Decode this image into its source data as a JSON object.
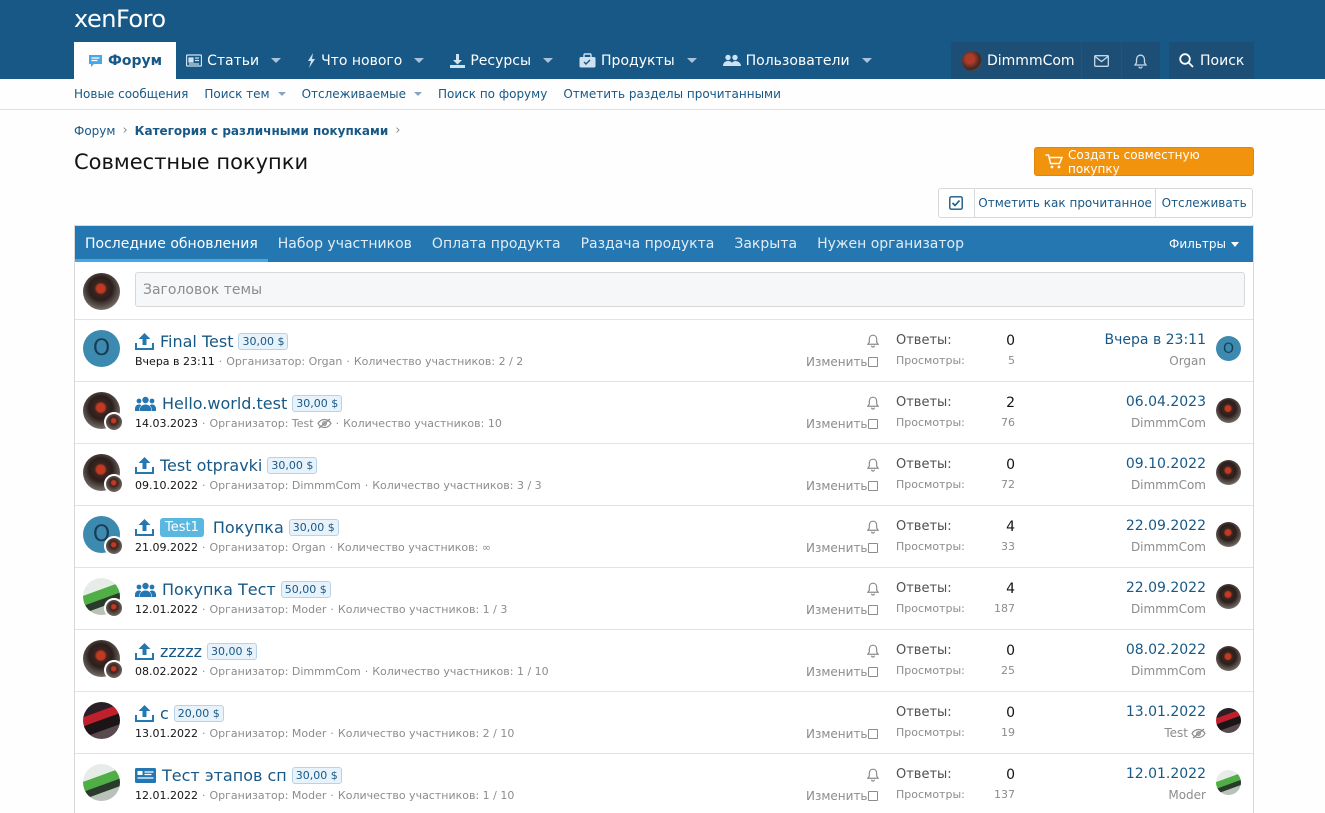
{
  "header": {
    "logo": "xenForo",
    "nav": [
      {
        "label": "Форум",
        "icon": "forum-icon",
        "active": true
      },
      {
        "label": "Статьи",
        "icon": "articles-icon"
      },
      {
        "label": "Что нового",
        "icon": "whats-new-icon"
      },
      {
        "label": "Ресурсы",
        "icon": "resources-icon"
      },
      {
        "label": "Продукты",
        "icon": "products-icon"
      },
      {
        "label": "Пользователи",
        "icon": "users-icon"
      }
    ],
    "user_name": "DimmmCom",
    "search_label": "Поиск"
  },
  "subnav": {
    "items": [
      {
        "label": "Новые сообщения"
      },
      {
        "label": "Поиск тем"
      },
      {
        "label": "Отслеживаемые"
      },
      {
        "label": "Поиск по форуму"
      },
      {
        "label": "Отметить разделы прочитанными"
      }
    ]
  },
  "breadcrumb": {
    "root": "Форум",
    "category": "Категория с различными покупками"
  },
  "page": {
    "title": "Совместные покупки",
    "create_button": "Создать совместную покупку",
    "mark_read": "Отметить как прочитанное",
    "watch": "Отслеживать"
  },
  "tabs": {
    "items": [
      {
        "label": "Последние обновления",
        "active": true
      },
      {
        "label": "Набор участников"
      },
      {
        "label": "Оплата продукта"
      },
      {
        "label": "Раздача продукта"
      },
      {
        "label": "Закрыта"
      },
      {
        "label": "Нужен организатор"
      }
    ],
    "filters": "Фильтры"
  },
  "quick_thread": {
    "placeholder": "Заголовок темы"
  },
  "labels": {
    "replies": "Ответы:",
    "views": "Просмотры:",
    "edit": "Изменить",
    "organizer": "Организатор:",
    "participants": "Количество участников:"
  },
  "threads": [
    {
      "icon": "upload-icon",
      "title": "Final Test",
      "price": "30,00 $",
      "prefix": "",
      "date": "Вчера в 23:11",
      "organizer": "Organ",
      "participants": "2 / 2",
      "replies": "0",
      "views": "5",
      "last_date": "Вчера в 23:11",
      "last_user": "Organ",
      "avatar": "letter",
      "avatar_letter": "O",
      "mini": false,
      "last_avatar": "letter",
      "bell": true,
      "organizer_hidden": false,
      "last_hidden": false
    },
    {
      "icon": "group-icon",
      "title": "Hello.world.test",
      "price": "30,00 $",
      "prefix": "",
      "date": "14.03.2023",
      "organizer": "Test",
      "participants": "10",
      "replies": "2",
      "views": "76",
      "last_date": "06.04.2023",
      "last_user": "DimmmCom",
      "avatar": "char",
      "avatar_letter": "",
      "mini": true,
      "last_avatar": "char",
      "bell": true,
      "organizer_hidden": true,
      "last_hidden": false
    },
    {
      "icon": "upload-icon",
      "title": "Test otpravki",
      "price": "30,00 $",
      "prefix": "",
      "date": "09.10.2022",
      "organizer": "DimmmCom",
      "participants": "3 / 3",
      "replies": "0",
      "views": "72",
      "last_date": "09.10.2022",
      "last_user": "DimmmCom",
      "avatar": "char",
      "avatar_letter": "",
      "mini": true,
      "last_avatar": "char",
      "bell": true,
      "organizer_hidden": false,
      "last_hidden": false
    },
    {
      "icon": "upload-icon",
      "title": "Покупка",
      "price": "30,00 $",
      "prefix": "Test1",
      "date": "21.09.2022",
      "organizer": "Organ",
      "participants": "∞",
      "replies": "4",
      "views": "33",
      "last_date": "22.09.2022",
      "last_user": "DimmmCom",
      "avatar": "letter",
      "avatar_letter": "O",
      "mini": true,
      "last_avatar": "char",
      "bell": true,
      "organizer_hidden": false,
      "last_hidden": false
    },
    {
      "icon": "group-icon",
      "title": "Покупка Тест",
      "price": "50,00 $",
      "prefix": "",
      "date": "12.01.2022",
      "organizer": "Moder",
      "participants": "1 / 3",
      "replies": "4",
      "views": "187",
      "last_date": "22.09.2022",
      "last_user": "DimmmCom",
      "avatar": "car",
      "avatar_letter": "",
      "mini": true,
      "last_avatar": "char",
      "bell": true,
      "organizer_hidden": false,
      "last_hidden": false
    },
    {
      "icon": "upload-icon",
      "title": "zzzzz",
      "price": "30,00 $",
      "prefix": "",
      "date": "08.02.2022",
      "organizer": "DimmmCom",
      "participants": "1 / 10",
      "replies": "0",
      "views": "25",
      "last_date": "08.02.2022",
      "last_user": "DimmmCom",
      "avatar": "char",
      "avatar_letter": "",
      "mini": true,
      "last_avatar": "char",
      "bell": true,
      "organizer_hidden": false,
      "last_hidden": false
    },
    {
      "icon": "upload-icon",
      "title": "с",
      "price": "20,00 $",
      "prefix": "",
      "date": "13.01.2022",
      "organizer": "Moder",
      "participants": "2 / 10",
      "replies": "0",
      "views": "19",
      "last_date": "13.01.2022",
      "last_user": "Test",
      "avatar": "car-dark",
      "avatar_letter": "",
      "mini": false,
      "last_avatar": "car-dark",
      "bell": false,
      "organizer_hidden": false,
      "last_hidden": true
    },
    {
      "icon": "card-icon",
      "title": "Тест этапов сп",
      "price": "30,00 $",
      "prefix": "",
      "date": "12.01.2022",
      "organizer": "Moder",
      "participants": "1 / 10",
      "replies": "0",
      "views": "137",
      "last_date": "12.01.2022",
      "last_user": "Moder",
      "avatar": "car",
      "avatar_letter": "",
      "mini": false,
      "last_avatar": "car",
      "bell": true,
      "organizer_hidden": false,
      "last_hidden": false
    }
  ]
}
